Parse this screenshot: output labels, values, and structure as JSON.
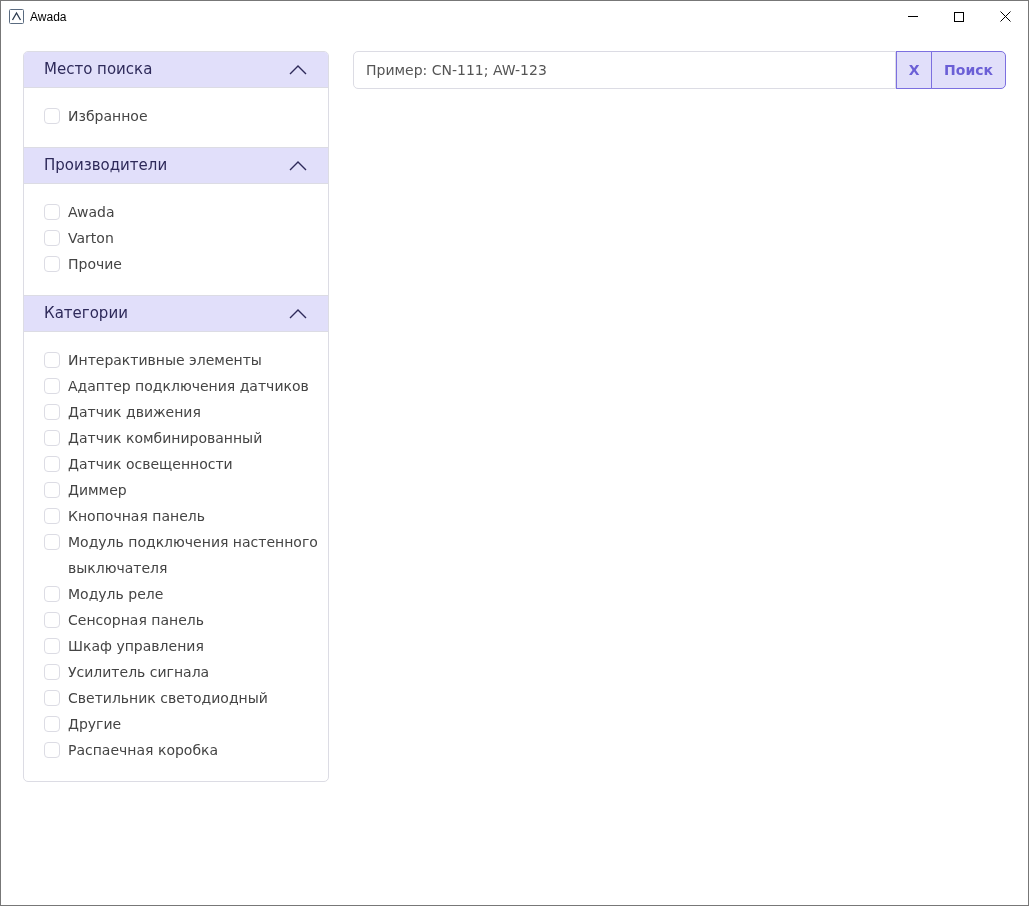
{
  "window": {
    "title": "Awada"
  },
  "sections": [
    {
      "title": "Место поиска",
      "expanded": true,
      "items": [
        {
          "label": "Избранное",
          "checked": false
        }
      ]
    },
    {
      "title": "Производители",
      "expanded": true,
      "items": [
        {
          "label": "Awada",
          "checked": false
        },
        {
          "label": "Varton",
          "checked": false
        },
        {
          "label": "Прочие",
          "checked": false
        }
      ]
    },
    {
      "title": "Категории",
      "expanded": true,
      "items": [
        {
          "label": "Интерактивные элементы",
          "checked": false
        },
        {
          "label": "Адаптер подключения датчиков",
          "checked": false
        },
        {
          "label": "Датчик движения",
          "checked": false
        },
        {
          "label": "Датчик комбинированный",
          "checked": false
        },
        {
          "label": "Датчик освещенности",
          "checked": false
        },
        {
          "label": "Диммер",
          "checked": false
        },
        {
          "label": "Кнопочная панель",
          "checked": false
        },
        {
          "label": "Модуль подключения настенного выключателя",
          "checked": false
        },
        {
          "label": "Модуль реле",
          "checked": false
        },
        {
          "label": "Сенсорная панель",
          "checked": false
        },
        {
          "label": "Шкаф управления",
          "checked": false
        },
        {
          "label": "Усилитель сигнала",
          "checked": false
        },
        {
          "label": "Светильник светодиодный",
          "checked": false
        },
        {
          "label": "Другие",
          "checked": false
        },
        {
          "label": "Распаечная коробка",
          "checked": false
        }
      ]
    }
  ],
  "search": {
    "placeholder": "Пример: CN-111; AW-123",
    "buttons": [
      "X",
      "Поиск"
    ]
  }
}
